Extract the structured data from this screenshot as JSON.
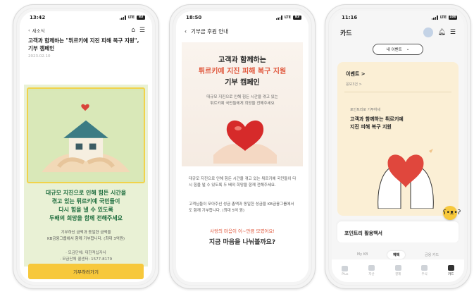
{
  "phone1": {
    "time": "13:42",
    "network": "LTE",
    "battery": "83",
    "back_label": "새소식",
    "title": "고객과 함께하는 \"튀르키예 지진 피해 복구 지원\", 기부 캠페인",
    "date": "2023.02.10",
    "headline": [
      "대규모 지진으로 인해 힘든 시간을",
      "겪고 있는 튀르키예 국민들이",
      "다시 힘을 낼 수 있도록",
      "두배의 희망을 함께 전해주세요"
    ],
    "body": [
      "기부하신 금액과 동일한 금액을",
      "KB금융그룹에서 함께 기부합니다. (최대 3억원)"
    ],
    "info": [
      "· 모금단체: 대한적십자사",
      "· 모금단체 콜센터: 1577-8179"
    ],
    "donate_button": "기부하러가기"
  },
  "phone2": {
    "time": "18:50",
    "network": "LTE",
    "battery": "83",
    "header_title": "기부금 후원 안내",
    "hero_line1": "고객과 함께하는",
    "hero_line2": "튀르키예 지진 피해 복구 지원",
    "hero_line3": "기부 캠페인",
    "hero_sub": [
      "대규모 지진으로 인해 힘든 시간을 겪고 있는",
      "튀르키예 국민들에게 희망을 전해주세요"
    ],
    "para1": "대규모 지진으로 인해 힘든 시간을 겪고 있는 튀르키예 국민들이 다시 힘을 낼 수 있도록 두 배의 희망을 함께 전해주세요.",
    "para2": "고객님들이 모아주신 성금 총액과 동일한 성금을 KB금융그룹에서도 함께 기부합니다. (최대 5억 원)",
    "red_text": "사랑의 마음이 이~만큼 모였어요!",
    "cta_text": "지금 마음을 나눠볼까요?"
  },
  "phone3": {
    "time": "11:16",
    "network": "LTE",
    "battery": "100",
    "header_title": "카드",
    "chip_label": "내 이벤트",
    "events_label": "이벤트 >",
    "events_count": "응모3건 >",
    "event_small": "포인트리로 기부하세",
    "event_title": [
      "고객과 함께하는 튀르키예",
      "지진 피해 복구 지원"
    ],
    "report_label": "포인트리 활용백서",
    "tabs": [
      "My KB",
      "혜택",
      "금융 카드"
    ],
    "bottom_nav": [
      "Plus",
      "자산",
      "결제",
      "주식",
      "카드"
    ]
  },
  "colors": {
    "green_headline": "#1f6e3f",
    "accent_red": "#e0593e",
    "button_yellow": "#f7c83b"
  }
}
